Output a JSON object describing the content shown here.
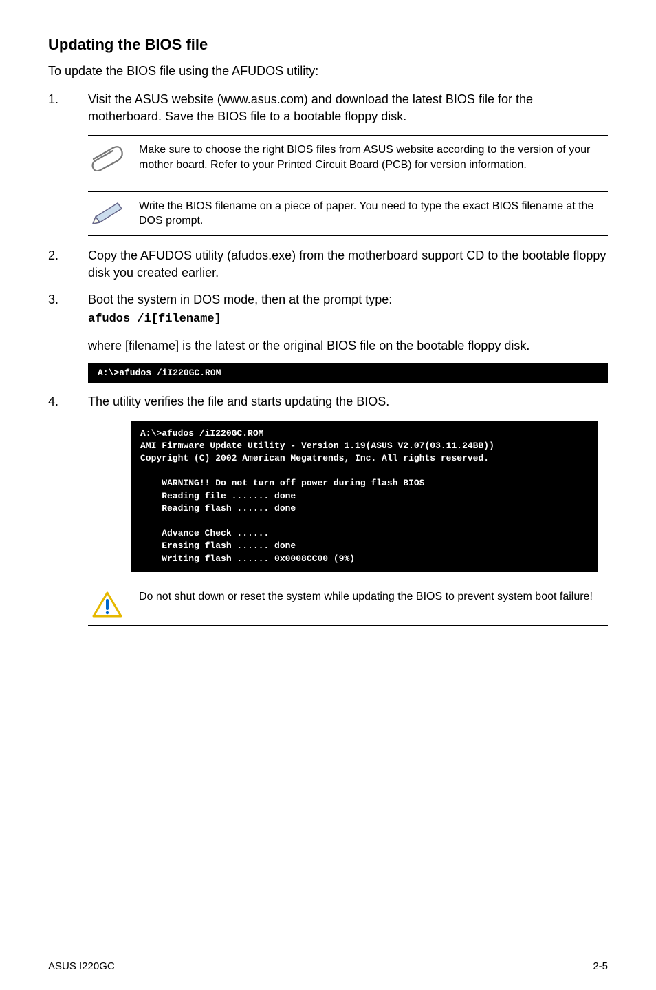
{
  "heading": "Updating the BIOS file",
  "intro": "To update the BIOS file using the AFUDOS utility:",
  "step1": {
    "num": "1.",
    "text": "Visit the ASUS website (www.asus.com) and download the latest BIOS file for the motherboard. Save the BIOS file to a bootable floppy disk."
  },
  "note1": "Make sure to choose the right BIOS files from ASUS website according to the version of your mother board. Refer to your Printed Circuit Board (PCB) for version information.",
  "note2": "Write the BIOS filename on a piece of paper. You need to type the exact BIOS filename at the DOS prompt.",
  "step2": {
    "num": "2.",
    "text": "Copy the AFUDOS utility (afudos.exe) from the motherboard support CD to the bootable floppy disk you created earlier."
  },
  "step3": {
    "num": "3.",
    "text": "Boot the system in DOS mode, then at the prompt type:",
    "cmd": "afudos /i[filename]"
  },
  "where_line": "where [filename] is the latest or the original BIOS file on the bootable floppy disk.",
  "term1": "A:\\>afudos /iI220GC.ROM",
  "step4": {
    "num": "4.",
    "text": "The utility verifies the file and starts updating the BIOS."
  },
  "term2": "A:\\>afudos /iI220GC.ROM\nAMI Firmware Update Utility - Version 1.19(ASUS V2.07(03.11.24BB))\nCopyright (C) 2002 American Megatrends, Inc. All rights reserved.\n\n    WARNING!! Do not turn off power during flash BIOS\n    Reading file ....... done\n    Reading flash ...... done\n\n    Advance Check ......\n    Erasing flash ...... done\n    Writing flash ...... 0x0008CC00 (9%)",
  "caution": "Do not shut down or reset the system while updating the BIOS to prevent system boot failure!",
  "footer_left": "ASUS I220GC",
  "footer_right": "2-5"
}
